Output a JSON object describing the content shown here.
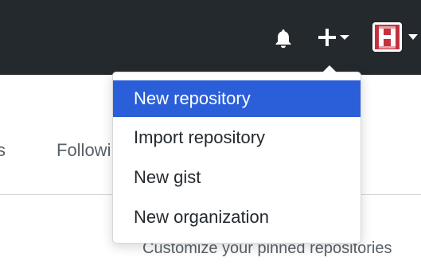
{
  "header": {
    "icons": {
      "notifications": "bell-icon",
      "create": "plus-icon",
      "create_caret": "caret-down-icon",
      "user_caret": "caret-down-icon"
    },
    "colors": {
      "background": "#24292e",
      "icon": "#ffffff",
      "avatar": "#c2323e"
    }
  },
  "profile_nav": {
    "partial_tab": "s",
    "following_tab": "Followi"
  },
  "pinned": {
    "customize_text": "Customize your pinned repositories"
  },
  "dropdown": {
    "items": [
      {
        "label": "New repository",
        "active": true
      },
      {
        "label": "Import repository",
        "active": false
      },
      {
        "label": "New gist",
        "active": false
      },
      {
        "label": "New organization",
        "active": false
      }
    ],
    "colors": {
      "active_bg": "#2b5fd9",
      "active_text": "#ffffff",
      "text": "#24292e"
    }
  }
}
